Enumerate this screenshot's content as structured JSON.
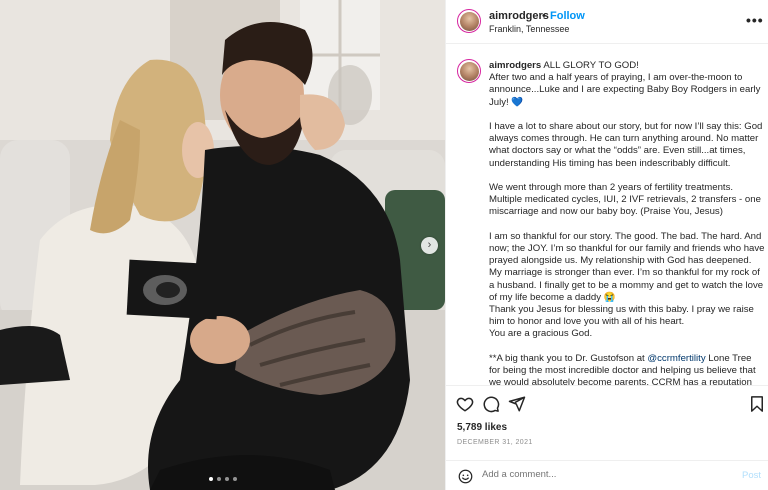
{
  "post": {
    "username": "aimrodgers",
    "separator": "•",
    "follow_label": "Follow",
    "location": "Franklin, Tennessee",
    "more_icon": "more-horizontal-icon",
    "more_label": "•••"
  },
  "carousel": {
    "next_label": "›",
    "dot_count": 4,
    "active_dot": 0
  },
  "caption": {
    "username": "aimrodgers",
    "first_line": "ALL GLORY TO GOD!",
    "p1": "After two and a half years of praying, I am over-the-moon to announce...Luke and I are expecting Baby Boy Rodgers in early July! 💙",
    "p2": "I have a lot to share about our story, but for now I’ll say this: God always comes through. He can turn anything around. No matter what doctors say or what the “odds” are. Even still...at times, understanding His timing has been indescribably difficult.",
    "p3": "We went through more than 2 years of fertility treatments. Multiple medicated cycles, IUI, 2 IVF retrievals, 2 transfers - one miscarriage and now our baby boy. (Praise You, Jesus)",
    "p4": "I am so thankful for our story. The good. The bad. The hard. And now; the JOY. I’m so thankful for our family and friends who have prayed alongside us. My relationship with God has deepened. My marriage is stronger than ever. I’m so thankful for my rock of a husband. I finally get to be a mommy and get to watch the love of my life become a daddy 😭",
    "p5": "Thank you Jesus for blessing us with this baby. I pray we raise him to honor and love you with all of his heart.",
    "p6": "You are a gracious God.",
    "p7_pre": "**A big thank you to Dr. Gustofson at ",
    "p7_mention": "@ccrmfertility",
    "p7_post": " Lone Tree for being the most incredible doctor and helping us believe that we would absolutely become parents. CCRM has a reputation for"
  },
  "actions": {
    "like_icon": "heart-icon",
    "comment_icon": "comment-icon",
    "share_icon": "share-icon",
    "save_icon": "bookmark-icon",
    "likes": "5,789 likes",
    "date": "DECEMBER 31, 2021"
  },
  "comment": {
    "emoji_icon": "emoji-icon",
    "placeholder": "Add a comment...",
    "post_label": "Post"
  },
  "colors": {
    "follow": "#0095f6",
    "post_disabled": "#b2dffc",
    "heart_blue": "#3897f0"
  }
}
